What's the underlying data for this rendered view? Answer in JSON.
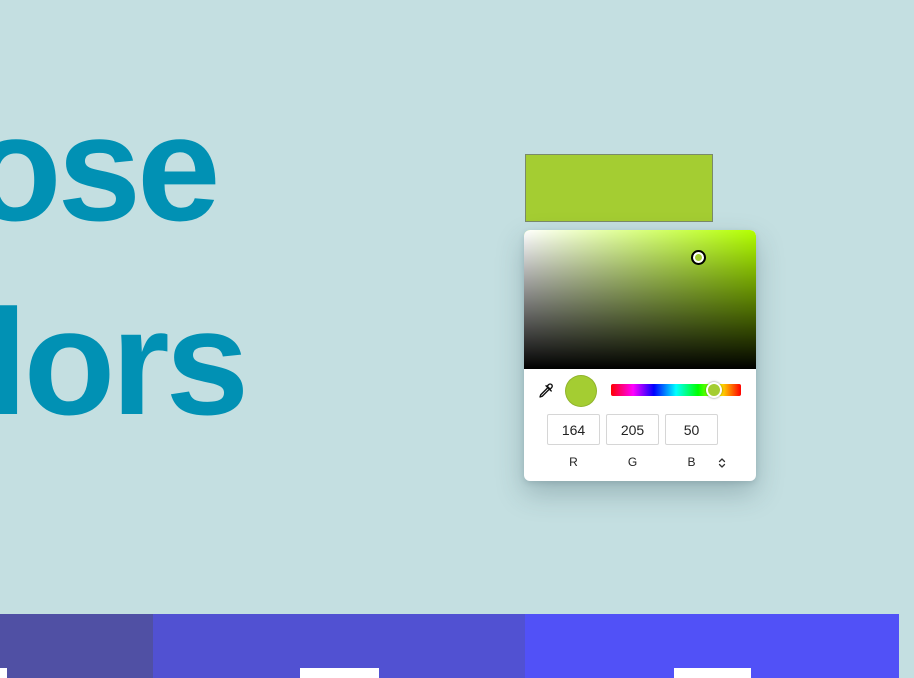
{
  "headline": {
    "line1": "ose",
    "line2": "lors"
  },
  "picker": {
    "selected_color": "#a4cd32",
    "hue_color": "#b3ff00",
    "saturation_cursor": {
      "saturation": 0.75,
      "value": 0.8
    },
    "hue_level": 0.79,
    "eyedropper_icon": "eyedropper-icon",
    "mode_toggle_icon": "chevron-up-down-icon",
    "r_value": "164",
    "g_value": "205",
    "b_value": "50",
    "r_label": "R",
    "g_label": "G",
    "b_label": "B"
  },
  "palette": {
    "colors": [
      "#5050a4",
      "#5151d2",
      "#5151f7"
    ]
  }
}
